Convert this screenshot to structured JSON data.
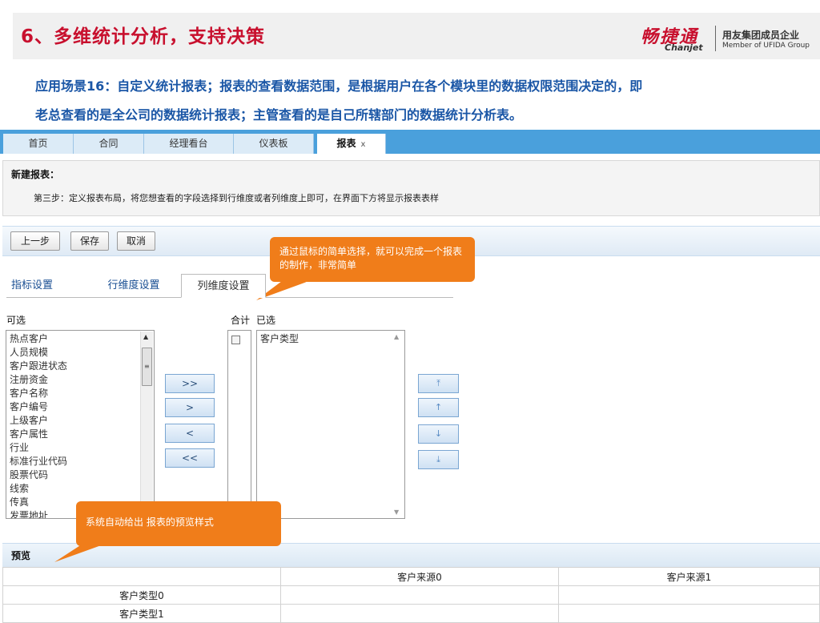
{
  "slide": {
    "title": "6、多维统计分析，支持决策",
    "scenario_line1": "应用场景16：自定义统计报表；报表的查看数据范围，是根据用户在各个模块里的数据权限范围决定的，即",
    "scenario_line2": "老总查看的是全公司的数据统计报表；主管查看的是自己所辖部门的数据统计分析表。"
  },
  "brand": {
    "logo_cn": "畅捷通",
    "logo_en": "Chanjet",
    "group_cn": "用友集团成员企业",
    "group_en": "Member of UFIDA Group",
    "color": "#c8102e"
  },
  "tabs": [
    {
      "label": "首页"
    },
    {
      "label": "合同"
    },
    {
      "label": "经理看台"
    },
    {
      "label": "仪表板"
    },
    {
      "label": "报表",
      "close": "x",
      "active": true
    }
  ],
  "info": {
    "title": "新建报表：",
    "step": "第三步：定义报表布局，将您想查看的字段选择到行维度或者列维度上即可，在界面下方将显示报表表样"
  },
  "toolbar": {
    "prev": "上一步",
    "save": "保存",
    "cancel": "取消"
  },
  "callouts": {
    "select_tip": "通过鼠标的简单选择，就可以完成一个报表的制作，非常简单",
    "preview_tip": "系统自动给出 报表的预览样式",
    "color": "#f07d1a"
  },
  "settings_tabs": [
    {
      "label": "指标设置"
    },
    {
      "label": "行维度设置"
    },
    {
      "label": "列维度设置",
      "active": true
    }
  ],
  "available": {
    "label": "可选",
    "items": [
      "热点客户",
      "人员规模",
      "客户跟进状态",
      "注册资金",
      "客户名称",
      "客户编号",
      "上级客户",
      "客户属性",
      "行业",
      "标准行业代码",
      "股票代码",
      "线索",
      "传真",
      "发票地址"
    ]
  },
  "move_buttons": {
    "add_all": ">>",
    "add": ">",
    "remove": "<",
    "remove_all": "<<"
  },
  "sum": {
    "label": "合计"
  },
  "selected": {
    "label": "已选",
    "items": [
      "客户类型"
    ]
  },
  "preview": {
    "title": "预览",
    "header": [
      "",
      "客户来源0",
      "客户来源1"
    ],
    "rows": [
      [
        "客户类型0",
        "",
        ""
      ],
      [
        "客户类型1",
        "",
        ""
      ]
    ]
  },
  "colors": {
    "tabbar": "#4aa0dc",
    "title_red": "#c8102e",
    "scenario_blue": "#1a56a6"
  }
}
